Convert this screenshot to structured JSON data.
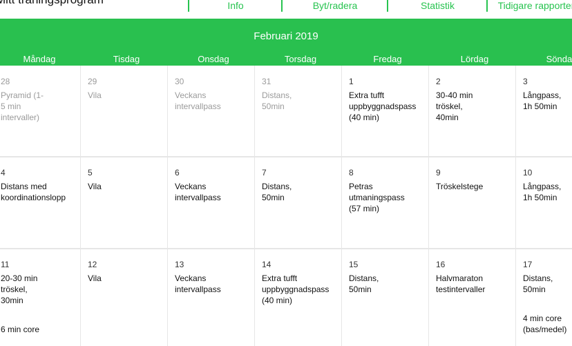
{
  "header": {
    "title": "Mitt träningsprogram",
    "nav": [
      "Info",
      "Byt/radera",
      "Statistik",
      "Tidigare rapporter"
    ]
  },
  "calendar": {
    "month": "Februari 2019",
    "weekdays": [
      "Måndag",
      "Tisdag",
      "Onsdag",
      "Torsdag",
      "Fredag",
      "Lördag",
      "Söndag"
    ],
    "weeks": [
      [
        {
          "day": "28",
          "text": "Pyramid (1-\n5 min\nintervaller)",
          "muted": true
        },
        {
          "day": "29",
          "text": "Vila",
          "muted": true
        },
        {
          "day": "30",
          "text": "Veckans\nintervallpass",
          "muted": true
        },
        {
          "day": "31",
          "text": "Distans,\n50min",
          "muted": true
        },
        {
          "day": "1",
          "text": "Extra tufft\nuppbyggnadspass\n(40 min)"
        },
        {
          "day": "2",
          "text": "30-40 min\ntröskel,\n40min"
        },
        {
          "day": "3",
          "text": "Långpass,\n1h 50min"
        }
      ],
      [
        {
          "day": "4",
          "text": "Distans med\nkoordinationslopp"
        },
        {
          "day": "5",
          "text": "Vila"
        },
        {
          "day": "6",
          "text": "Veckans\nintervallpass"
        },
        {
          "day": "7",
          "text": "Distans,\n50min"
        },
        {
          "day": "8",
          "text": "Petras\nutmaningspass\n(57 min)"
        },
        {
          "day": "9",
          "text": "Tröskelstege"
        },
        {
          "day": "10",
          "text": "Långpass,\n1h 50min"
        }
      ],
      [
        {
          "day": "11",
          "text": "20-30 min\ntröskel,\n30min",
          "extra": "6 min core"
        },
        {
          "day": "12",
          "text": "Vila"
        },
        {
          "day": "13",
          "text": "Veckans\nintervallpass"
        },
        {
          "day": "14",
          "text": "Extra tufft\nuppbyggnadspass\n(40 min)"
        },
        {
          "day": "15",
          "text": "Distans,\n50min"
        },
        {
          "day": "16",
          "text": "Halvmaraton\ntestintervaller"
        },
        {
          "day": "17",
          "text": "Distans,\n50min",
          "extra": "4 min core\n(bas/medel)"
        }
      ]
    ]
  }
}
